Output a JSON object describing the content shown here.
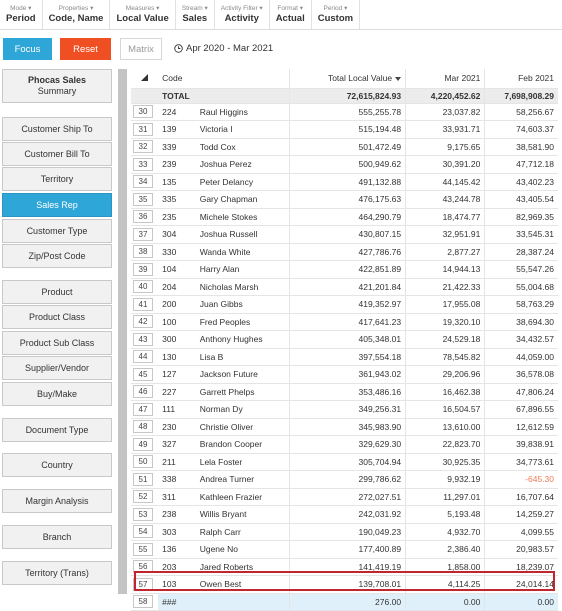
{
  "toolbar": [
    {
      "top": "Mode ▾",
      "value": "Period"
    },
    {
      "top": "Properties ▾",
      "value": "Code, Name"
    },
    {
      "top": "Measures ▾",
      "value": "Local Value"
    },
    {
      "top": "Stream ▾",
      "value": "Sales"
    },
    {
      "top": "Activity Filter ▾",
      "value": "Activity"
    },
    {
      "top": "Format ▾",
      "value": "Actual"
    },
    {
      "top": "Period ▾",
      "value": "Custom"
    }
  ],
  "actions": {
    "focus": "Focus",
    "reset": "Reset",
    "matrix": "Matrix",
    "date_range": "Apr 2020 - Mar 2021"
  },
  "sidebar": {
    "summary_title": "Phocas Sales",
    "summary_sub": "Summary",
    "items": [
      "Customer Ship To",
      "Customer Bill To",
      "Territory",
      "Sales Rep",
      "Customer Type",
      "Zip/Post Code",
      "Product",
      "Product Class",
      "Product Sub Class",
      "Supplier/Vendor",
      "Buy/Make",
      "Document Type",
      "Country",
      "Margin Analysis",
      "Branch",
      "Territory (Trans)"
    ],
    "active_item": "Sales Rep"
  },
  "grid": {
    "headers": {
      "code": "Code",
      "tlv": "Total Local Value",
      "mar": "Mar 2021",
      "feb": "Feb 2021"
    },
    "total": {
      "label": "TOTAL",
      "tlv": "72,615,824.93",
      "mar": "4,220,452.62",
      "feb": "7,698,908.29"
    },
    "rows": [
      [
        "30",
        "224",
        "Raul Higgins",
        "555,255.78",
        "23,037.82",
        "58,256.67"
      ],
      [
        "31",
        "139",
        "Victoria I",
        "515,194.48",
        "33,931.71",
        "74,603.37"
      ],
      [
        "32",
        "339",
        "Todd Cox",
        "501,472.49",
        "9,175.65",
        "38,581.90"
      ],
      [
        "33",
        "239",
        "Joshua Perez",
        "500,949.62",
        "30,391.20",
        "47,712.18"
      ],
      [
        "34",
        "135",
        "Peter Delancy",
        "491,132.88",
        "44,145.42",
        "43,402.23"
      ],
      [
        "35",
        "335",
        "Gary Chapman",
        "476,175.63",
        "43,244.78",
        "43,405.54"
      ],
      [
        "36",
        "235",
        "Michele Stokes",
        "464,290.79",
        "18,474.77",
        "82,969.35"
      ],
      [
        "37",
        "304",
        "Joshua Russell",
        "430,807.15",
        "32,951.91",
        "33,545.31"
      ],
      [
        "38",
        "330",
        "Wanda White",
        "427,786.76",
        "2,877.27",
        "28,387.24"
      ],
      [
        "39",
        "104",
        "Harry Alan",
        "422,851.89",
        "14,944.13",
        "55,547.26"
      ],
      [
        "40",
        "204",
        "Nicholas Marsh",
        "421,201.84",
        "21,422.33",
        "55,004.68"
      ],
      [
        "41",
        "200",
        "Juan Gibbs",
        "419,352.97",
        "17,955.08",
        "58,763.29"
      ],
      [
        "42",
        "100",
        "Fred Peoples",
        "417,641.23",
        "19,320.10",
        "38,694.30"
      ],
      [
        "43",
        "300",
        "Anthony Hughes",
        "405,348.01",
        "24,529.18",
        "34,432.57"
      ],
      [
        "44",
        "130",
        "Lisa B",
        "397,554.18",
        "78,545.82",
        "44,059.00"
      ],
      [
        "45",
        "127",
        "Jackson Future",
        "361,943.02",
        "29,206.96",
        "36,578.08"
      ],
      [
        "46",
        "227",
        "Garrett Phelps",
        "353,486.16",
        "16,462.38",
        "47,806.24"
      ],
      [
        "47",
        "111",
        "Norman Dy",
        "349,256.31",
        "16,504.57",
        "67,896.55"
      ],
      [
        "48",
        "230",
        "Christie Oliver",
        "345,983.90",
        "13,610.00",
        "12,612.59"
      ],
      [
        "49",
        "327",
        "Brandon Cooper",
        "329,629.30",
        "22,823.70",
        "39,838.91"
      ],
      [
        "50",
        "211",
        "Lela Foster",
        "305,704.94",
        "30,925.35",
        "34,773.61"
      ],
      [
        "51",
        "338",
        "Andrea Turner",
        "299,786.62",
        "9,932.19",
        "-645.30"
      ],
      [
        "52",
        "311",
        "Kathleen Frazier",
        "272,027.51",
        "11,297.01",
        "16,707.64"
      ],
      [
        "53",
        "238",
        "Willis Bryant",
        "242,031.92",
        "5,193.48",
        "14,259.27"
      ],
      [
        "54",
        "303",
        "Ralph Carr",
        "190,049.23",
        "4,932.70",
        "4,099.55"
      ],
      [
        "55",
        "136",
        "Ugene No",
        "177,400.89",
        "2,386.40",
        "20,983.57"
      ],
      [
        "56",
        "203",
        "Jared Roberts",
        "141,419.19",
        "1,858.00",
        "18,239.07"
      ],
      [
        "57",
        "103",
        "Owen Best",
        "139,708.01",
        "4,114.25",
        "24,014.14"
      ],
      [
        "58",
        "###",
        "",
        "276.00",
        "0.00",
        "0.00"
      ]
    ]
  }
}
